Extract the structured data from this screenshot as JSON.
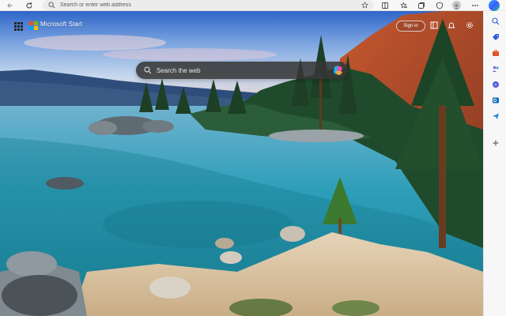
{
  "toolbar": {
    "address_placeholder": "Search or enter web address"
  },
  "header": {
    "brand_label": "Microsoft Start",
    "signin_label": "Sign in"
  },
  "search": {
    "placeholder": "Search the web"
  },
  "icons": {
    "back": "back-arrow-icon",
    "refresh": "refresh-icon",
    "search": "search-icon",
    "favorite": "star-icon",
    "apps": "apps-grid-icon",
    "settings": "gear-icon",
    "more": "more-icon",
    "copilot": "copilot-icon"
  },
  "colors": {
    "ms_red": "#f25022",
    "ms_green": "#7fba00",
    "ms_blue": "#00a4ef",
    "ms_yellow": "#ffb900"
  }
}
